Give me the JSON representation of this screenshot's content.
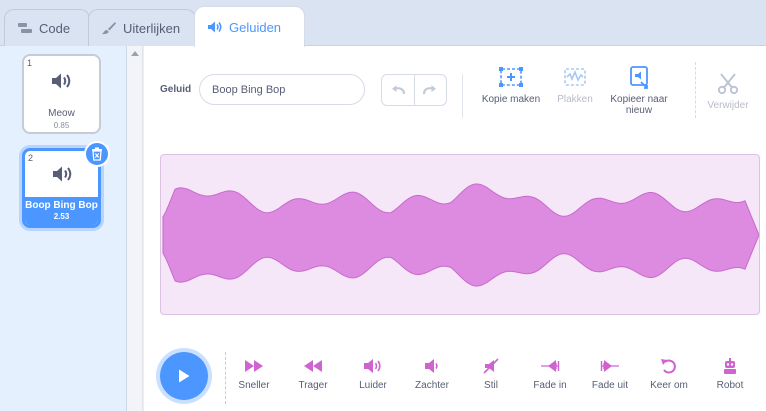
{
  "tabs": {
    "code": "Code",
    "costumes": "Uiterlijken",
    "sounds": "Geluiden"
  },
  "sounds": [
    {
      "number": "1",
      "name": "Meow",
      "duration": "0.85"
    },
    {
      "number": "2",
      "name": "Boop Bing Bop",
      "duration": "2.53"
    }
  ],
  "editor": {
    "name_label": "Geluid",
    "name_value": "Boop Bing Bop",
    "copy": "Kopie maken",
    "paste": "Plakken",
    "copy_new": "Kopieer naar nieuw",
    "delete": "Verwijder"
  },
  "effects": {
    "faster": "Sneller",
    "slower": "Trager",
    "louder": "Luider",
    "softer": "Zachter",
    "mute": "Stil",
    "fade_in": "Fade in",
    "fade_out": "Fade uit",
    "reverse": "Keer om",
    "robot": "Robot"
  },
  "colors": {
    "accent": "#4c97ff",
    "sound_purple": "#cf63cf",
    "wave_fill": "#dc8be0",
    "wave_bg": "#f5e6f8"
  }
}
